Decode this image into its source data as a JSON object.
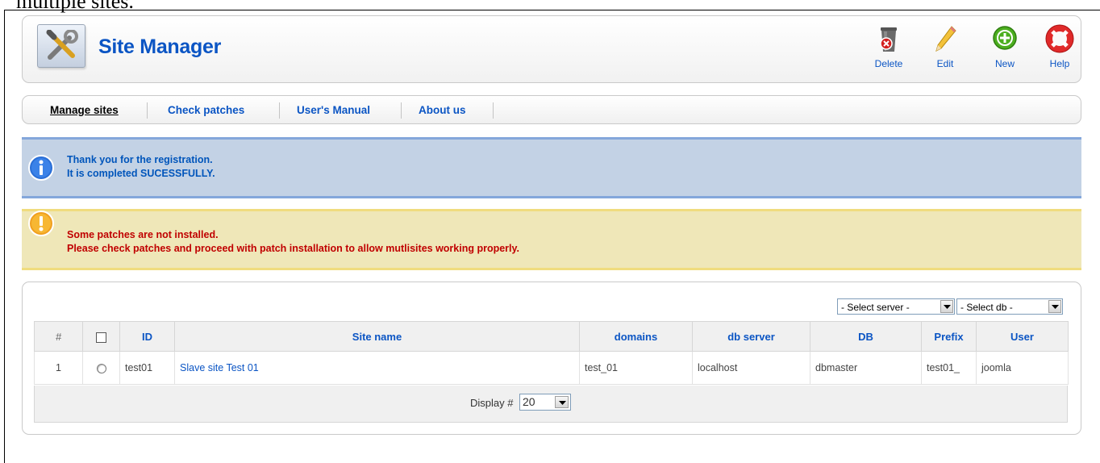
{
  "document": {
    "caption": "multiple sites."
  },
  "header": {
    "title": "Site Manager"
  },
  "toolbar": {
    "delete_label": "Delete",
    "edit_label": "Edit",
    "new_label": "New",
    "help_label": "Help"
  },
  "menu": {
    "items": [
      {
        "label": "Manage sites",
        "active": true
      },
      {
        "label": "Check patches",
        "active": false
      },
      {
        "label": "User's Manual",
        "active": false
      },
      {
        "label": "About us",
        "active": false
      }
    ]
  },
  "messages": {
    "info": {
      "line1": "Thank you for the registration.",
      "line2": "It is completed SUCESSFULLY."
    },
    "warning": {
      "line1": "Some patches are not installed.",
      "line2": "Please check patches and proceed with patch installation to allow mutlisites working properly."
    }
  },
  "filters": {
    "server_select": "- Select server -",
    "db_select": "- Select db -"
  },
  "table": {
    "headers": [
      "#",
      "",
      "ID",
      "Site name",
      "domains",
      "db server",
      "DB",
      "Prefix",
      "User"
    ],
    "rows": [
      {
        "num": "1",
        "id": "test01",
        "site_name": "Slave site Test 01",
        "domains": "test_01",
        "db_server": "localhost",
        "db": "dbmaster",
        "prefix": "test01_",
        "user": "joomla"
      }
    ]
  },
  "pagination": {
    "display_label": "Display #",
    "limit": "20"
  },
  "colors": {
    "link_blue": "#0b55c4",
    "info_bg": "#c3d2e5",
    "info_border": "#84a7db",
    "warning_bg": "#efe7b8",
    "warning_text": "#c00000"
  },
  "icons": {
    "logo": "tools-icon",
    "delete": "trash-delete-icon",
    "edit": "pencil-icon",
    "new": "plus-circle-icon",
    "help": "lifebuoy-icon",
    "info": "info-icon",
    "warning": "warning-icon"
  }
}
